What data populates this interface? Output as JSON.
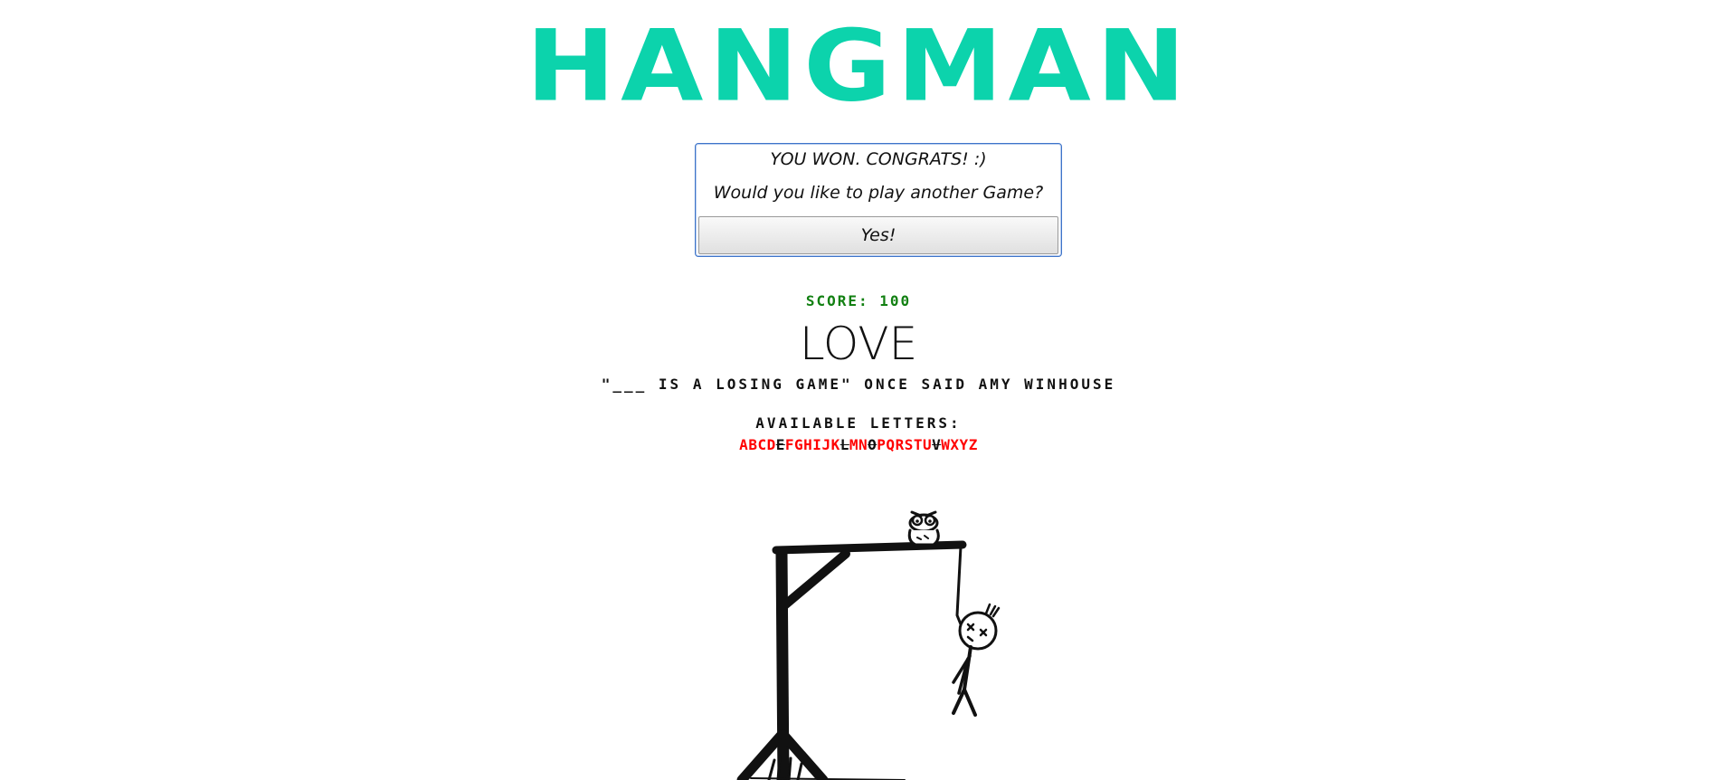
{
  "app": {
    "title": "HANGMAN",
    "title_color": "#0cd3ac"
  },
  "dialog": {
    "message": "YOU WON. CONGRATS! :)",
    "question": "Would you like to play another Game?",
    "yes_label": "Yes!"
  },
  "score": {
    "text": "SCORE: 100",
    "value": 100,
    "color": "#128012"
  },
  "word": "LOVE",
  "hint": "\"___ IS A LOSING GAME\" ONCE SAID AMY WINHOUSE",
  "available_letters": {
    "label": "AVAILABLE LETTERS:",
    "letters": [
      {
        "ch": "A",
        "used": false
      },
      {
        "ch": "B",
        "used": false
      },
      {
        "ch": "C",
        "used": false
      },
      {
        "ch": "D",
        "used": false
      },
      {
        "ch": "E",
        "used": true
      },
      {
        "ch": "F",
        "used": false
      },
      {
        "ch": "G",
        "used": false
      },
      {
        "ch": "H",
        "used": false
      },
      {
        "ch": "I",
        "used": false
      },
      {
        "ch": "J",
        "used": false
      },
      {
        "ch": "K",
        "used": false
      },
      {
        "ch": "L",
        "used": true
      },
      {
        "ch": "M",
        "used": false
      },
      {
        "ch": "N",
        "used": false
      },
      {
        "ch": "O",
        "used": true
      },
      {
        "ch": "P",
        "used": false
      },
      {
        "ch": "Q",
        "used": false
      },
      {
        "ch": "R",
        "used": false
      },
      {
        "ch": "S",
        "used": false
      },
      {
        "ch": "T",
        "used": false
      },
      {
        "ch": "U",
        "used": false
      },
      {
        "ch": "V",
        "used": true
      },
      {
        "ch": "W",
        "used": false
      },
      {
        "ch": "X",
        "used": false
      },
      {
        "ch": "Y",
        "used": false
      },
      {
        "ch": "Z",
        "used": false
      }
    ],
    "available_color": "#ff0000",
    "used_color": "#111111"
  },
  "illustration": {
    "icon": "hanged-stickman-gallows-with-owl"
  }
}
